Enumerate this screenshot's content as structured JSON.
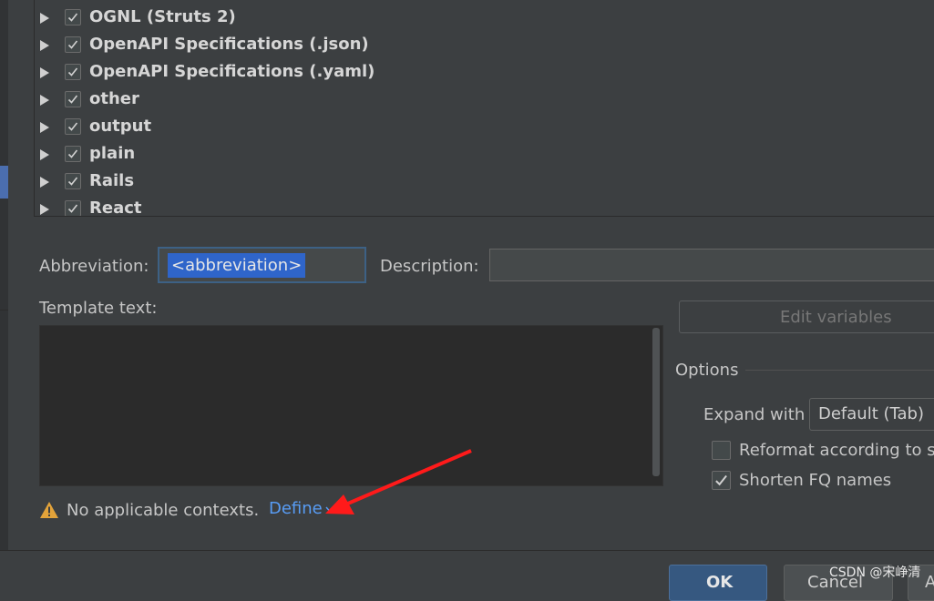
{
  "tree": {
    "items": [
      {
        "label": "OGNL (Struts 2)",
        "checked": true
      },
      {
        "label": "OpenAPI Specifications (.json)",
        "checked": true
      },
      {
        "label": "OpenAPI Specifications (.yaml)",
        "checked": true
      },
      {
        "label": "other",
        "checked": true
      },
      {
        "label": "output",
        "checked": true
      },
      {
        "label": "plain",
        "checked": true
      },
      {
        "label": "Rails",
        "checked": true
      },
      {
        "label": "React",
        "checked": true
      }
    ]
  },
  "form": {
    "abbreviation_label": "Abbreviation:",
    "abbreviation_value": "<abbreviation>",
    "description_label": "Description:",
    "description_value": "",
    "template_label": "Template text:",
    "template_value": ""
  },
  "buttons": {
    "edit_variables": "Edit variables",
    "ok": "OK",
    "cancel": "Cancel",
    "apply": "A"
  },
  "options": {
    "title": "Options",
    "expand_label": "Expand with",
    "expand_value": "Default (Tab)",
    "reformat_label": "Reformat according to st",
    "reformat_checked": false,
    "shorten_label": "Shorten FQ names",
    "shorten_checked": true
  },
  "context": {
    "warning": "No applicable contexts.",
    "define_link": "Define"
  },
  "watermark": "CSDN @宋峥清",
  "colors": {
    "background": "#3c3f41",
    "selection": "#2f65ca",
    "link": "#589df6",
    "ok_button": "#365880",
    "warning_icon": "#e3a33a",
    "annotation_arrow": "#ff1a1a"
  }
}
